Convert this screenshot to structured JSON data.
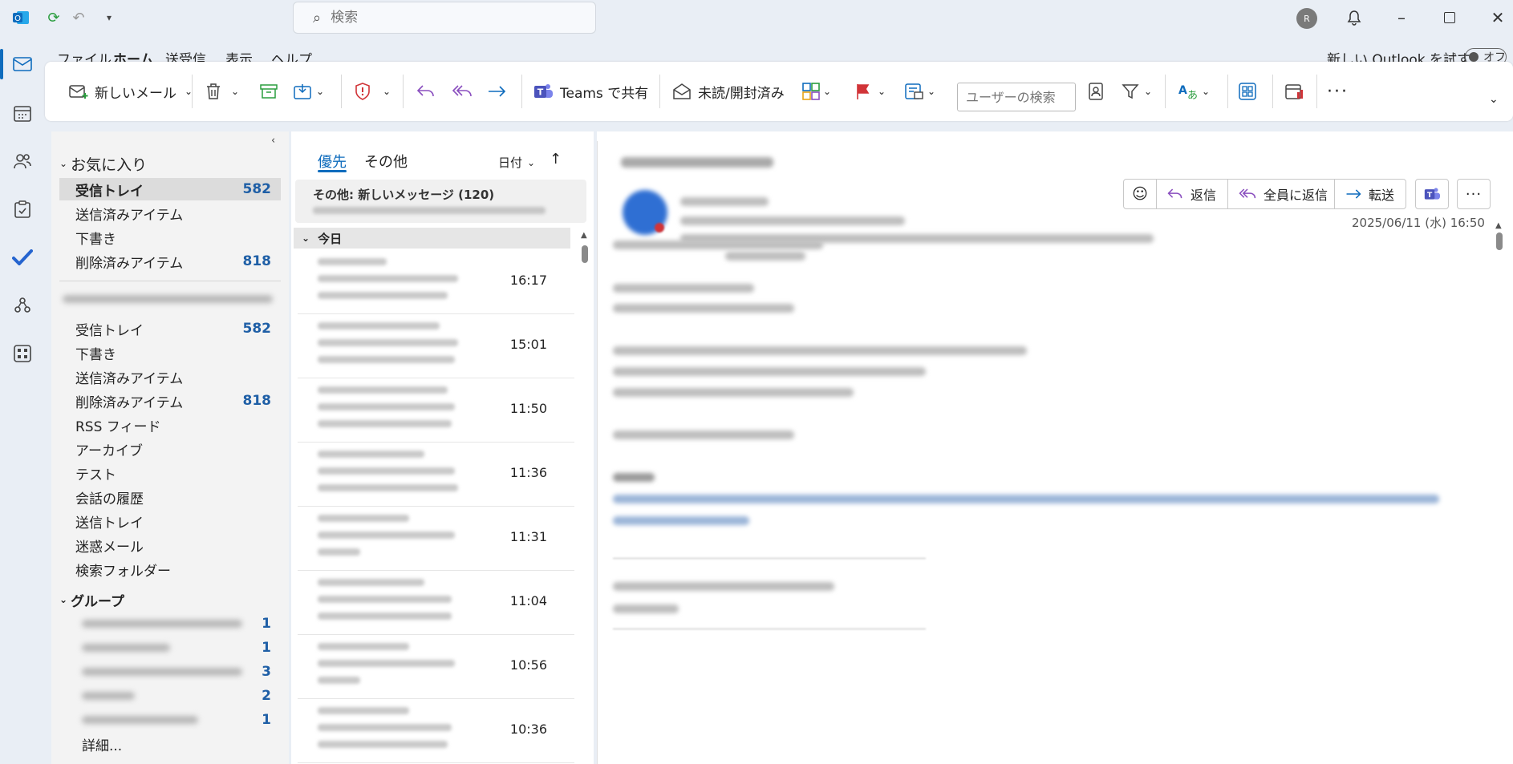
{
  "app": {
    "search_placeholder": "検索",
    "try_new": "新しい Outlook を試す",
    "toggle_label": "オフ",
    "avatar_initials": "R"
  },
  "menu": {
    "tabs": [
      "ファイル",
      "ホーム",
      "送受信",
      "表示",
      "ヘルプ"
    ],
    "active": "ホーム"
  },
  "ribbon": {
    "new_mail": "新しいメール",
    "teams_share": "Teams で共有",
    "unread_read": "未読/開封済み",
    "user_search_placeholder": "ユーザーの検索"
  },
  "favorites": {
    "header": "お気に入り",
    "items": [
      {
        "label": "受信トレイ",
        "count": "582"
      },
      {
        "label": "送信済みアイテム",
        "count": ""
      },
      {
        "label": "下書き",
        "count": ""
      },
      {
        "label": "削除済みアイテム",
        "count": "818"
      }
    ]
  },
  "account": {
    "items": [
      {
        "label": "受信トレイ",
        "count": "582"
      },
      {
        "label": "下書き",
        "count": ""
      },
      {
        "label": "送信済みアイテム",
        "count": ""
      },
      {
        "label": "削除済みアイテム",
        "count": "818"
      },
      {
        "label": "RSS フィード",
        "count": ""
      },
      {
        "label": "アーカイブ",
        "count": ""
      },
      {
        "label": "テスト",
        "count": ""
      },
      {
        "label": "会話の履歴",
        "count": ""
      },
      {
        "label": "送信トレイ",
        "count": ""
      },
      {
        "label": "迷惑メール",
        "count": ""
      },
      {
        "label": "検索フォルダー",
        "count": ""
      }
    ]
  },
  "groups": {
    "header": "グループ",
    "counts": [
      "1",
      "1",
      "3",
      "2",
      "1"
    ],
    "more": "詳細..."
  },
  "message_list": {
    "tab_focused": "優先",
    "tab_other": "その他",
    "sort": "日付",
    "other_banner": "その他: 新しいメッセージ (120)",
    "section_today": "今日",
    "times": [
      "16:17",
      "15:01",
      "11:50",
      "11:36",
      "11:31",
      "11:04",
      "10:56",
      "10:36"
    ]
  },
  "reading": {
    "reply": "返信",
    "reply_all": "全員に返信",
    "forward": "転送",
    "date": "2025/06/11 (水) 16:50"
  },
  "colors": {
    "accent": "#0f6cbd",
    "count_blue": "#1f5fa6",
    "flag_red": "#d13438"
  }
}
